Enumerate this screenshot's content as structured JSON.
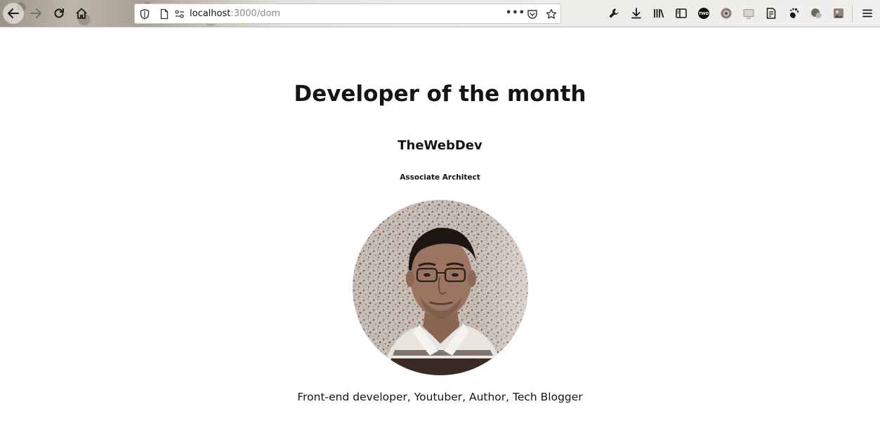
{
  "browser": {
    "url_host": "localhost",
    "url_path": ":3000/dom",
    "page_actions_label": "•••"
  },
  "page": {
    "title": "Developer of the month",
    "developer": {
      "name": "TheWebDev",
      "role": "Associate Architect",
      "bio": "Front-end developer, Youtuber, Author, Tech Blogger"
    }
  },
  "toolbar_icons": [
    "wrench-icon",
    "download-icon",
    "library-icon",
    "sidebar-icon",
    "twd-extension-icon",
    "extension-icon",
    "screenshot-icon",
    "notes-icon",
    "gnome-icon",
    "chat-extension-icon",
    "image-extension-icon",
    "menu-icon"
  ]
}
